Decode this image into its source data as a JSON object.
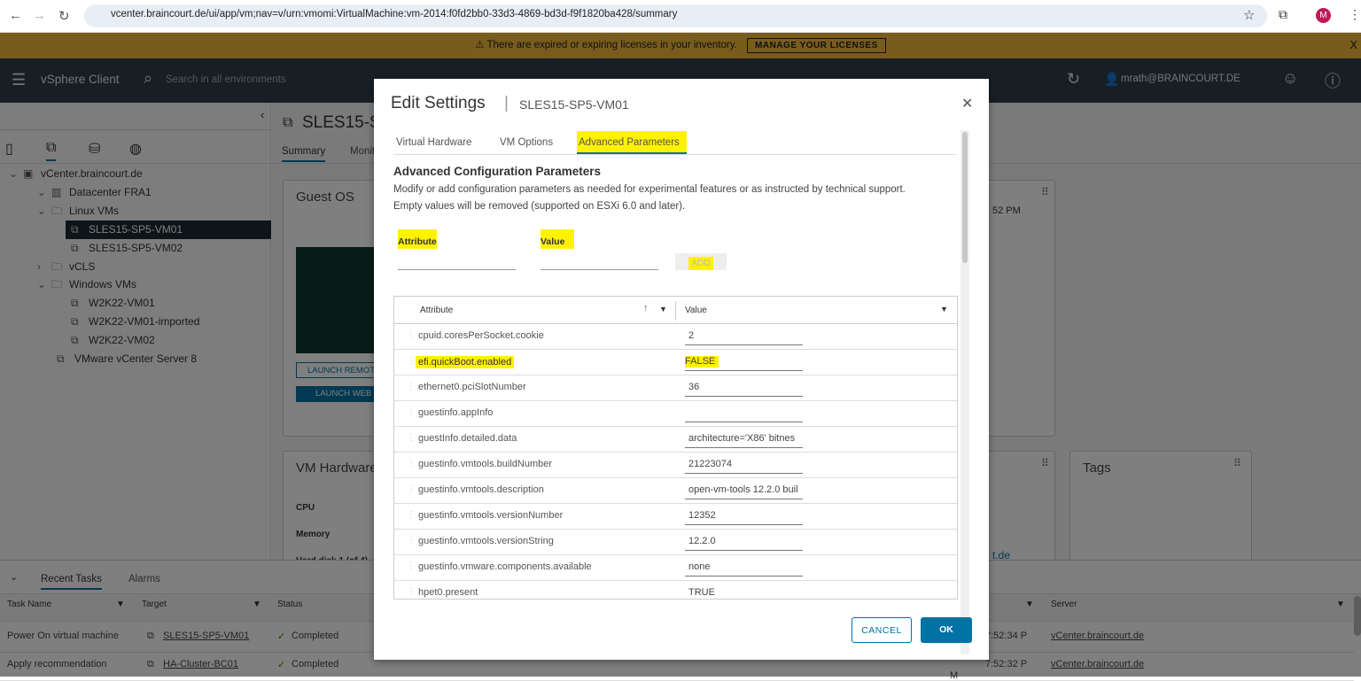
{
  "browser": {
    "url": "vcenter.braincourt.de/ui/app/vm;nav=v/urn:vmomi:VirtualMachine:vm-2014:f0fd2bb0-33d3-4869-bd3d-f9f1820ba428/summary",
    "profile_initial": "M"
  },
  "banner": {
    "message": "There are expired or expiring licenses in your inventory.",
    "button": "MANAGE YOUR LICENSES",
    "close": "X"
  },
  "header": {
    "app_name": "vSphere Client",
    "search_placeholder": "Search in all environments",
    "user": "mrath@BRAINCOURT.DE"
  },
  "tree": [
    {
      "label": "vCenter.braincourt.de",
      "level": 0,
      "expanded": true
    },
    {
      "label": "Datacenter FRA1",
      "level": 1,
      "expanded": true
    },
    {
      "label": "Linux VMs",
      "level": 2,
      "expanded": true
    },
    {
      "label": "SLES15-SP5-VM01",
      "level": 3,
      "selected": true
    },
    {
      "label": "SLES15-SP5-VM02",
      "level": 3
    },
    {
      "label": "vCLS",
      "level": 2,
      "expanded": false
    },
    {
      "label": "Windows VMs",
      "level": 2,
      "expanded": true
    },
    {
      "label": "W2K22-VM01",
      "level": 3
    },
    {
      "label": "W2K22-VM01-imported",
      "level": 3
    },
    {
      "label": "W2K22-VM02",
      "level": 3
    },
    {
      "label": "VMware vCenter Server 8",
      "level": 2
    }
  ],
  "main": {
    "title": "SLES15-SP5-VM01",
    "tabs": [
      "Summary",
      "Monitor"
    ],
    "guest_os_title": "Guest OS",
    "launch_remote": "LAUNCH REMOTE CONSOLE",
    "launch_web": "LAUNCH WEB CONSOLE",
    "vm_hardware_title": "VM Hardware",
    "hw_labels": [
      "CPU",
      "Memory",
      "Hard disk 1 (of 4)"
    ],
    "time_fragment": "52 PM",
    "link_fragment": "t.de",
    "tags_title": "Tags"
  },
  "tasks": {
    "tabs": [
      "Recent Tasks",
      "Alarms"
    ],
    "columns": [
      "Task Name",
      "Target",
      "Status",
      "Server"
    ],
    "rows": [
      {
        "task": "Power On virtual machine",
        "target": "SLES15-SP5-VM01",
        "status": "Completed",
        "time": "7:52:34 P",
        "time2": "M",
        "server": "vCenter.braincourt.de"
      },
      {
        "task": "Apply recommendation",
        "target": "HA-Cluster-BC01",
        "status": "Completed",
        "time": "7:52:32 P",
        "time2": "M",
        "server": "vCenter.braincourt.de"
      }
    ]
  },
  "modal": {
    "title": "Edit Settings",
    "subtitle": "SLES15-SP5-VM01",
    "tabs": [
      "Virtual Hardware",
      "VM Options",
      "Advanced Parameters"
    ],
    "active_tab": 2,
    "section_title": "Advanced Configuration Parameters",
    "desc1": "Modify or add configuration parameters as needed for experimental features or as instructed by technical support.",
    "desc2": "Empty values will be removed (supported on ESXi 6.0 and later).",
    "attr_label": "Attribute",
    "value_label": "Value",
    "add_button": "ADD",
    "grid_headers": [
      "Attribute",
      "Value"
    ],
    "rows": [
      {
        "attr": "cpuid.coresPerSocket.cookie",
        "value": "2"
      },
      {
        "attr": "efi.quickBoot.enabled",
        "value": "FALSE",
        "highlight": true
      },
      {
        "attr": "ethernet0.pciSlotNumber",
        "value": "36"
      },
      {
        "attr": "guestinfo.appInfo",
        "value": ""
      },
      {
        "attr": "guestInfo.detailed.data",
        "value": "architecture='X86' bitnes"
      },
      {
        "attr": "guestinfo.vmtools.buildNumber",
        "value": "21223074"
      },
      {
        "attr": "guestinfo.vmtools.description",
        "value": "open-vm-tools 12.2.0 buil"
      },
      {
        "attr": "guestinfo.vmtools.versionNumber",
        "value": "12352"
      },
      {
        "attr": "guestinfo.vmtools.versionString",
        "value": "12.2.0"
      },
      {
        "attr": "guestinfo.vmware.components.available",
        "value": "none"
      },
      {
        "attr": "hpet0.present",
        "value": "TRUE"
      }
    ],
    "cancel": "CANCEL",
    "ok": "OK"
  },
  "colors": {
    "accent": "#0072a3",
    "highlight": "#fff200",
    "header": "#1b2a32",
    "banner": "#f2b83a"
  }
}
